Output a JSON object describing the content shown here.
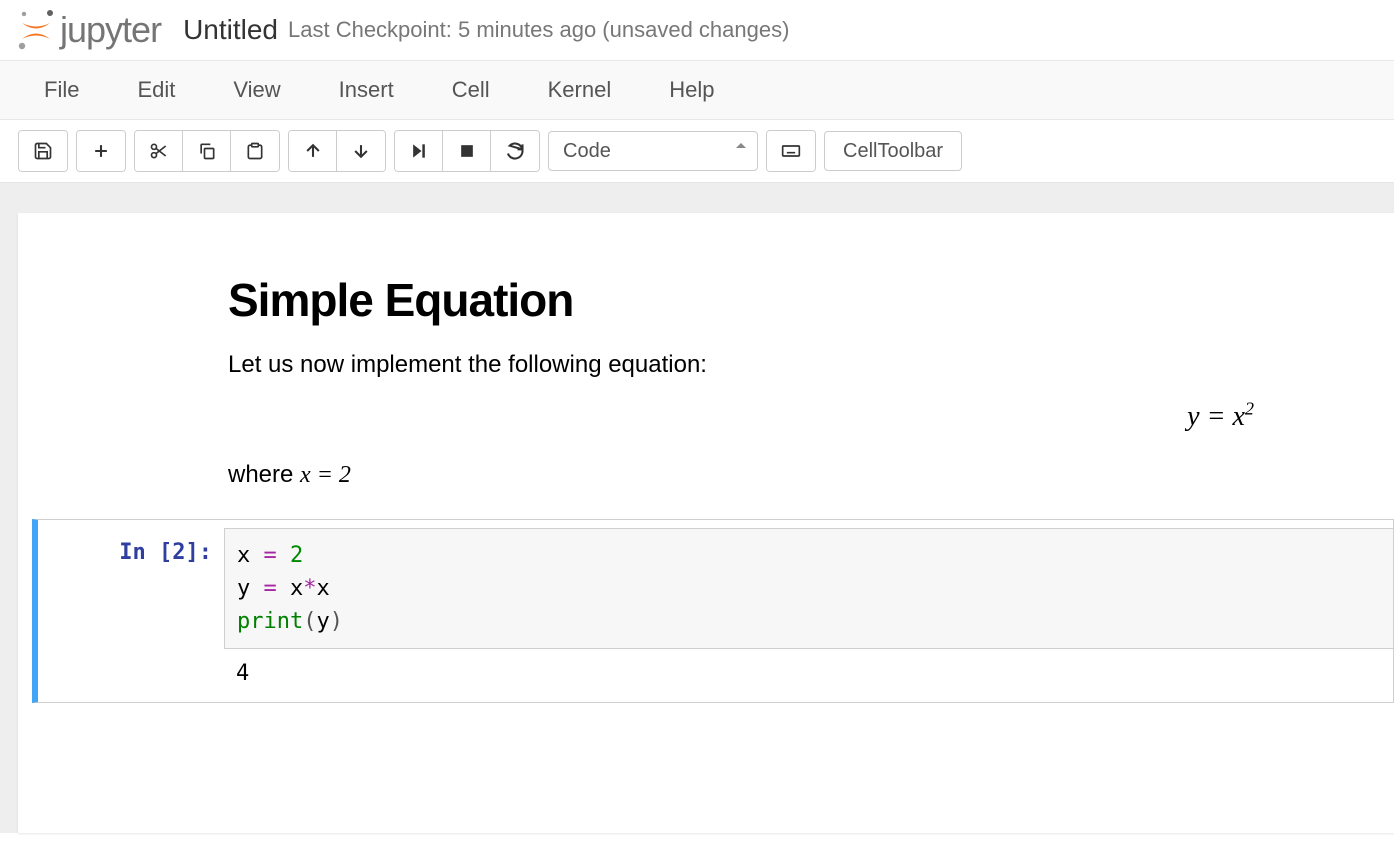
{
  "header": {
    "logo_text": "jupyter",
    "title": "Untitled",
    "checkpoint": "Last Checkpoint: 5 minutes ago (unsaved changes)"
  },
  "menu": {
    "items": [
      "File",
      "Edit",
      "View",
      "Insert",
      "Cell",
      "Kernel",
      "Help"
    ]
  },
  "toolbar": {
    "icons": {
      "save": "save-icon",
      "add": "plus-icon",
      "cut": "scissors-icon",
      "copy": "copy-icon",
      "paste": "paste-icon",
      "up": "arrow-up-icon",
      "down": "arrow-down-icon",
      "run": "step-forward-icon",
      "stop": "stop-icon",
      "restart": "refresh-icon",
      "keyboard": "keyboard-icon"
    },
    "cell_type": "Code",
    "cell_toolbar": "CellToolbar"
  },
  "cells": {
    "markdown": {
      "heading": "Simple Equation",
      "intro": "Let us now implement the following equation:",
      "equation_html": "y = x<sup>2</sup>",
      "where_prefix": "where ",
      "where_math": "x = 2"
    },
    "code": {
      "prompt": "In [2]:",
      "lines": {
        "l1": {
          "v1": "x",
          "op1": "=",
          "n1": "2"
        },
        "l2": {
          "v1": "y",
          "op1": "=",
          "v2": "x",
          "op2": "*",
          "v3": "x"
        },
        "l3": {
          "fn": "print",
          "arg": "y"
        }
      },
      "output": "4"
    }
  }
}
